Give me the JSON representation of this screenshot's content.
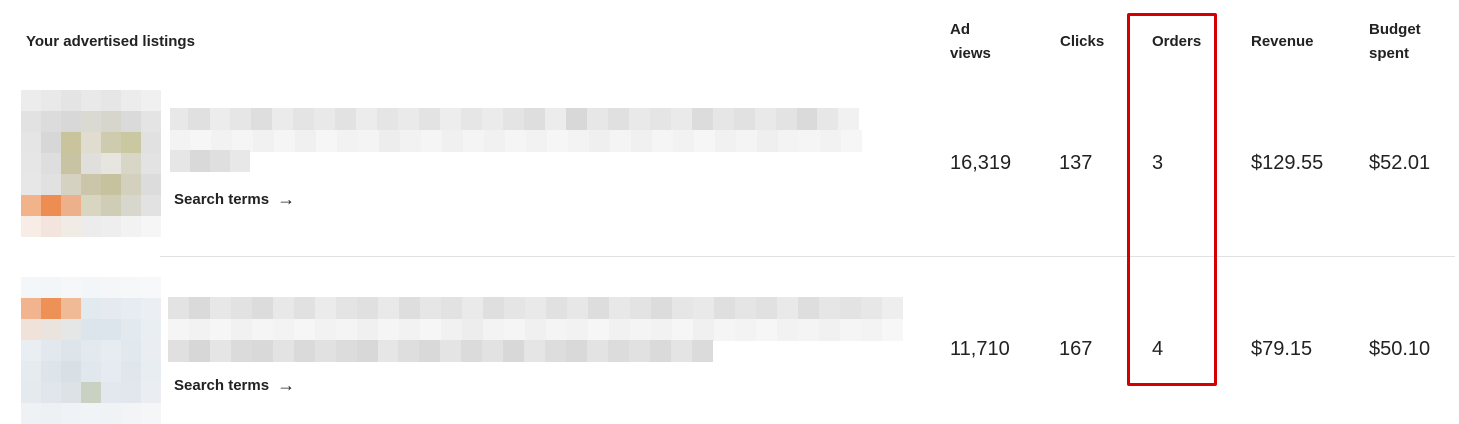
{
  "header": {
    "listings_label": "Your advertised listings",
    "ad_views": "Ad\nviews",
    "clicks": "Clicks",
    "orders": "Orders",
    "revenue": "Revenue",
    "budget_spent": "Budget\nspent"
  },
  "rows": [
    {
      "search_terms_label": "Search terms",
      "ad_views": "16,319",
      "clicks": "137",
      "orders": "3",
      "revenue": "$129.55",
      "budget_spent": "$52.01"
    },
    {
      "search_terms_label": "Search terms",
      "ad_views": "11,710",
      "clicks": "167",
      "orders": "4",
      "revenue": "$79.15",
      "budget_spent": "$50.10"
    }
  ],
  "icons": {
    "search_terms_arrow": "arrow-right-icon"
  },
  "colors": {
    "highlight": "#d40000"
  }
}
